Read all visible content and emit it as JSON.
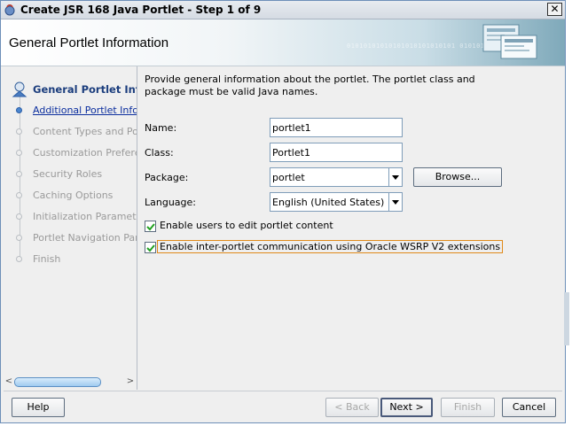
{
  "window": {
    "title": "Create JSR 168 Java Portlet - Step 1 of 9",
    "close_symbol": "✕"
  },
  "header": {
    "title": "General Portlet Information",
    "decoration_text": "01010101010101010101010101 01010101010"
  },
  "nav": {
    "items": [
      {
        "label": "General Portlet Information",
        "state": "current"
      },
      {
        "label": "Additional Portlet Information",
        "state": "link"
      },
      {
        "label": "Content Types and Portlet Modes",
        "state": "disabled"
      },
      {
        "label": "Customization Preferences",
        "state": "disabled"
      },
      {
        "label": "Security Roles",
        "state": "disabled"
      },
      {
        "label": "Caching Options",
        "state": "disabled"
      },
      {
        "label": "Initialization Parameters",
        "state": "disabled"
      },
      {
        "label": "Portlet Navigation Parameters",
        "state": "disabled"
      },
      {
        "label": "Finish",
        "state": "disabled"
      }
    ],
    "scroll_left": "<",
    "scroll_right": ">"
  },
  "form": {
    "instructions": "Provide general information about the portlet. The portlet class and package must be valid Java names.",
    "name_label": "Name:",
    "name_value": "portlet1",
    "class_label": "Class:",
    "class_value": "Portlet1",
    "package_label": "Package:",
    "package_value": "portlet",
    "browse_label": "Browse...",
    "language_label": "Language:",
    "language_value": "English (United States)",
    "checkbox_edit_label": "Enable users to edit portlet content",
    "checkbox_edit_checked": true,
    "checkbox_ipc_label": "Enable inter-portlet communication using Oracle WSRP V2 extensions",
    "checkbox_ipc_checked": true
  },
  "footer": {
    "help_label": "Help",
    "back_label": "< Back",
    "next_label": "Next >",
    "finish_label": "Finish",
    "cancel_label": "Cancel"
  },
  "colors": {
    "accent_link": "#0b2e9e",
    "current_step": "#1b3d7d",
    "focus_border": "#e08a1a"
  }
}
